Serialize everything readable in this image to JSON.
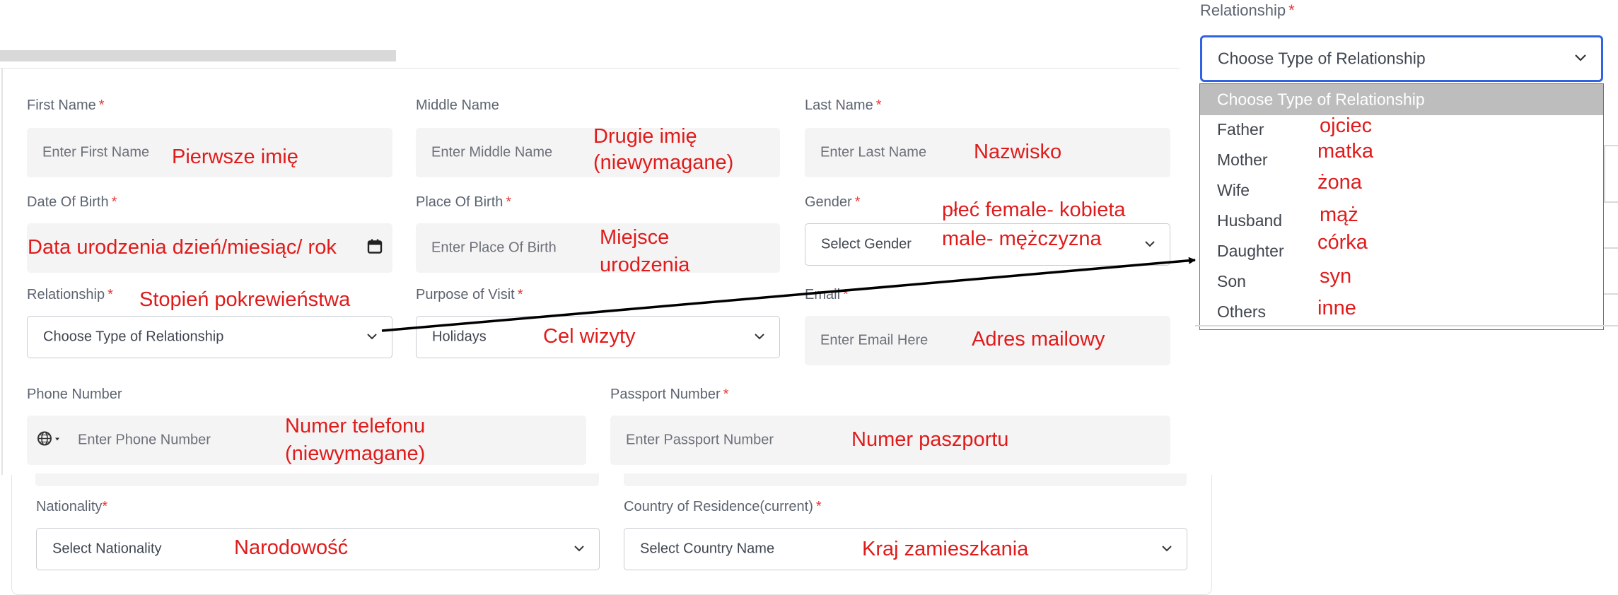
{
  "form": {
    "first_name": {
      "label": "First Name",
      "required": "*",
      "placeholder": "Enter First Name"
    },
    "middle_name": {
      "label": "Middle Name",
      "placeholder": "Enter Middle Name"
    },
    "last_name": {
      "label": "Last Name",
      "required": "*",
      "placeholder": "Enter Last Name"
    },
    "dob": {
      "label": "Date Of Birth",
      "required": "*"
    },
    "place_of_birth": {
      "label": "Place Of Birth",
      "required": "*",
      "placeholder": "Enter Place Of Birth"
    },
    "gender": {
      "label": "Gender",
      "required": "*",
      "value": "Select Gender"
    },
    "relationship": {
      "label": "Relationship",
      "required": "*",
      "value": "Choose Type of Relationship"
    },
    "purpose": {
      "label": "Purpose of Visit",
      "required": "*",
      "value": "Holidays"
    },
    "email": {
      "label": "Email",
      "required": "*",
      "placeholder": "Enter Email Here"
    },
    "phone": {
      "label": "Phone Number",
      "placeholder": "Enter Phone Number"
    },
    "passport": {
      "label": "Passport Number",
      "required": "*",
      "placeholder": "Enter Passport Number"
    },
    "nationality": {
      "label": "Nationality",
      "required": "*",
      "value": "Select Nationality"
    },
    "residence": {
      "label": "Country of Residence(current)",
      "required": "*",
      "value": "Select Country Name"
    }
  },
  "relationship_panel": {
    "label": "Relationship",
    "required": "*",
    "value": "Choose Type of Relationship",
    "options": [
      "Choose Type of Relationship",
      "Father",
      "Mother",
      "Wife",
      "Husband",
      "Daughter",
      "Son",
      "Others"
    ]
  },
  "annotations": {
    "first_name": "Pierwsze imię",
    "middle_name_1": "Drugie imię",
    "middle_name_2": "(niewymagane)",
    "last_name": "Nazwisko",
    "dob": "Data urodzenia dzień/miesiąc/ rok",
    "place_1": "Miejsce",
    "place_2": "urodzenia",
    "gender_1": "płeć female- kobieta",
    "gender_2": "male- mężczyzna",
    "relationship": "Stopień pokrewieństwa",
    "purpose": "Cel wizyty",
    "email": "Adres mailowy",
    "phone_1": "Numer telefonu",
    "phone_2": "(niewymagane)",
    "passport": "Numer paszportu",
    "nationality": "Narodowość",
    "residence": "Kraj zamieszkania",
    "opt_father": "ojciec",
    "opt_mother": "matka",
    "opt_wife": "żona",
    "opt_husband": "mąż",
    "opt_daughter": "córka",
    "opt_son": "syn",
    "opt_others": "inne"
  },
  "colors": {
    "annotation": "#e01b1b",
    "focus": "#2f63e3",
    "required": "#e53935",
    "arrow": "#000000"
  },
  "icons": {
    "select": "chevron-down-icon",
    "date": "calendar-icon",
    "phone": "globe-icon"
  }
}
